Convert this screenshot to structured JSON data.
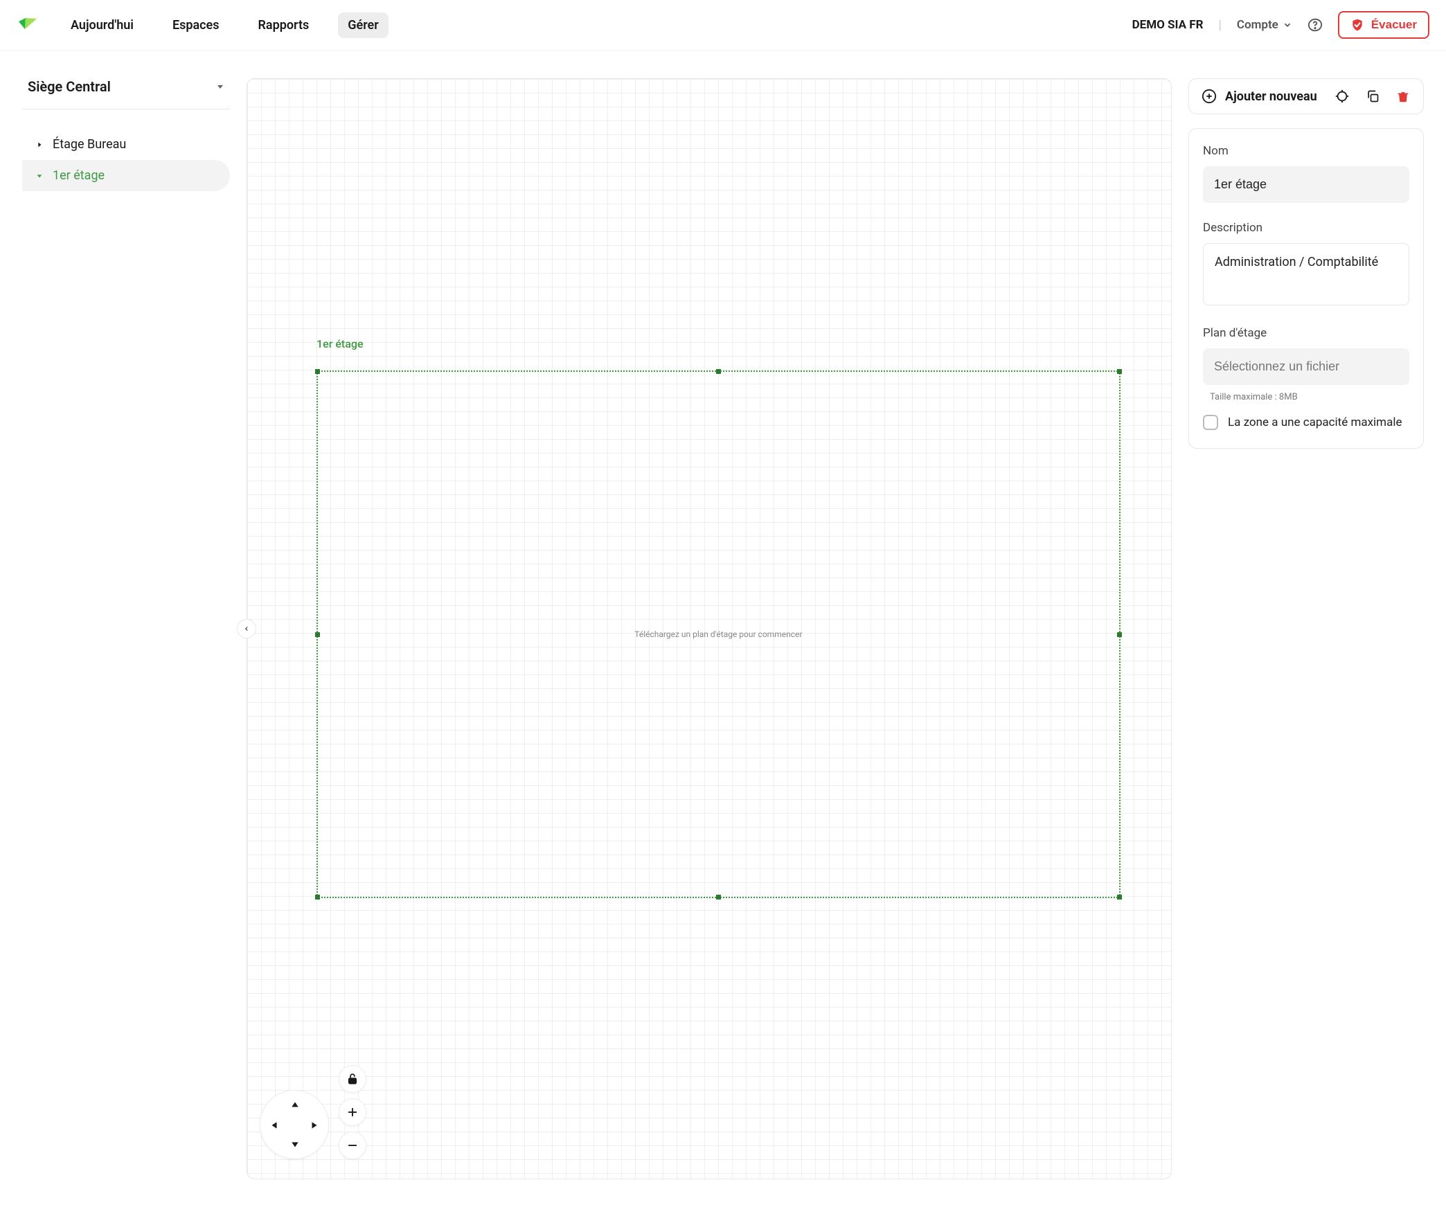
{
  "header": {
    "nav": {
      "today": "Aujourd'hui",
      "spaces": "Espaces",
      "reports": "Rapports",
      "manage": "Gérer"
    },
    "org": "DEMO SIA FR",
    "account": "Compte",
    "evacuate": "Évacuer"
  },
  "sidebar": {
    "building": "Siège Central",
    "floors": [
      {
        "label": "Étage Bureau",
        "state": "collapsed"
      },
      {
        "label": "1er étage",
        "state": "expanded"
      }
    ]
  },
  "canvas": {
    "zoneLabel": "1er étage",
    "uploadHint": "Téléchargez un plan d'étage pour commencer"
  },
  "toolbar": {
    "addNew": "Ajouter nouveau"
  },
  "form": {
    "nameLabel": "Nom",
    "nameValue": "1er étage",
    "descLabel": "Description",
    "descValue": "Administration / Comptabilité",
    "planLabel": "Plan d'étage",
    "filePlaceholder": "Sélectionnez un fichier",
    "sizeHint": "Taille maximale : 8MB",
    "capacityLabel": "La zone a une capacité maximale"
  }
}
